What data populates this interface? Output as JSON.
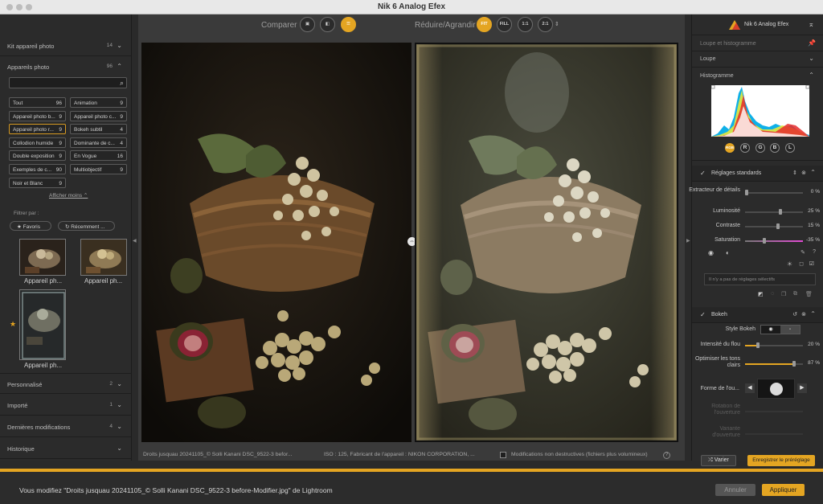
{
  "window": {
    "title": "Nik 6 Analog Efex"
  },
  "left_panel": {
    "camera_kit": {
      "label": "Kit appareil photo",
      "count": "14"
    },
    "cameras": {
      "label": "Appareils photo",
      "count": "96"
    },
    "tags": [
      {
        "label": "Tout",
        "count": "96"
      },
      {
        "label": "Animation",
        "count": "9"
      },
      {
        "label": "Appareil photo b...",
        "count": "9"
      },
      {
        "label": "Appareil photo c...",
        "count": "9"
      },
      {
        "label": "Appareil photo r...",
        "count": "9"
      },
      {
        "label": "Bokeh subtil",
        "count": "4"
      },
      {
        "label": "Collodion humide",
        "count": "9"
      },
      {
        "label": "Dominante de c...",
        "count": "4"
      },
      {
        "label": "Double exposition",
        "count": "9"
      },
      {
        "label": "En Vogue",
        "count": "16"
      },
      {
        "label": "Exemples de c...",
        "count": "90"
      },
      {
        "label": "Multiobjectif",
        "count": "9"
      },
      {
        "label": "Noir et Blanc",
        "count": "9"
      }
    ],
    "show_less": "Afficher moins",
    "filter_label": "Filtrer par :",
    "filter_favorites": "Favoris",
    "filter_recent": "Récemment ...",
    "thumbnails": [
      "Appareil ph...",
      "Appareil ph...",
      "Appareil ph..."
    ],
    "sections": [
      {
        "label": "Personnalisé",
        "count": "2"
      },
      {
        "label": "Importé",
        "count": "1"
      },
      {
        "label": "Dernières modifications",
        "count": "4"
      },
      {
        "label": "Historique",
        "count": ""
      }
    ]
  },
  "toolbar": {
    "compare_label": "Comparer",
    "zoom_label": "Réduire/Agrandir",
    "zoom_buttons": [
      "FIT",
      "FILL",
      "1:1",
      "2:1"
    ],
    "zoom_selected": "FIT"
  },
  "status_bar": {
    "filename": "Droits jusquau 20241105_© Solli Kanani DSC_9522-3 befor...",
    "exif": "ISO : 125, Fabricant de l'appareil : NIKON CORPORATION, ...",
    "nondestructive": "Modifications non destructives (fichiers plus volumineux)",
    "help": "?"
  },
  "right_panel": {
    "brand": "Nik 6 Analog Efex",
    "loupe_histogram": "Loupe et histogramme",
    "loupe": "Loupe",
    "histogram": "Histogramme",
    "channels": [
      "RGB",
      "R",
      "G",
      "B",
      "L"
    ],
    "standard_settings": {
      "title": "Réglages standards",
      "sliders": [
        {
          "name": "Extracteur de détails",
          "value": "0 %",
          "pct": 0
        },
        {
          "name": "Luminosité",
          "value": "25 %",
          "pct": 62
        },
        {
          "name": "Contraste",
          "value": "15 %",
          "pct": 57
        },
        {
          "name": "Saturation",
          "value": "-35 %",
          "pct": 32
        }
      ],
      "selective_empty": "Il n'y a pas de réglages sélectifs"
    },
    "bokeh": {
      "title": "Bokeh",
      "style_label": "Style Bokeh",
      "sliders": [
        {
          "name": "Intensité du flou",
          "value": "20 %",
          "pct": 20
        },
        {
          "name": "Optimiser les tons clairs",
          "value": "87 %",
          "pct": 87
        }
      ],
      "shape_label": "Forme de l'ou...",
      "rotation_label": "Rotation de l'ouverture",
      "variant_label": "Variante d'ouverture"
    },
    "vary_button": "Varier",
    "save_preset_button": "Enregistrer le préréglage"
  },
  "bottom_bar": {
    "message": "Vous modifiez \"Droits jusquau 20241105_© Solli Kanani DSC_9522-3 before-Modifier.jpg\" de Lightroom",
    "cancel": "Annuler",
    "apply": "Appliquer"
  },
  "colors": {
    "accent": "#e4a522",
    "panel": "#2b2b2b",
    "canvas": "#3a3a3a"
  }
}
